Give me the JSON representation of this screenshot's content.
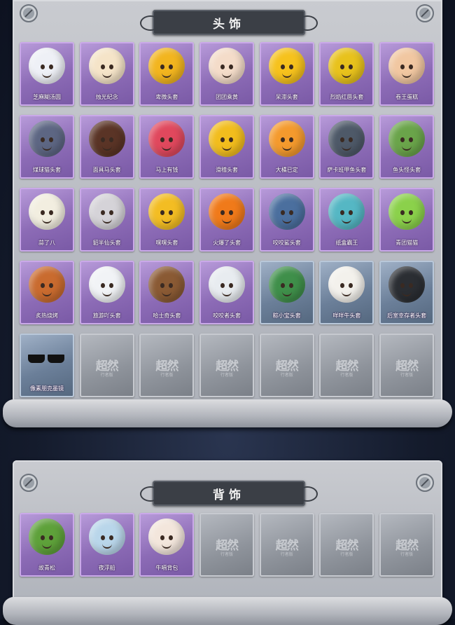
{
  "sections": {
    "head": {
      "title": "头饰",
      "items": [
        {
          "label": "芝麻糊汤圆",
          "rarity": "purple",
          "color": "#eef0f6"
        },
        {
          "label": "烛光纪念",
          "rarity": "purple",
          "color": "#f5e4c8"
        },
        {
          "label": "卑微头套",
          "rarity": "purple",
          "color": "#f2b51f"
        },
        {
          "label": "团团乘黄",
          "rarity": "purple",
          "color": "#f4dcc9"
        },
        {
          "label": "呆滞头套",
          "rarity": "purple",
          "color": "#f6c21d"
        },
        {
          "label": "烈焰红唇头套",
          "rarity": "purple",
          "color": "#e8c21c"
        },
        {
          "label": "卷王蛋糕",
          "rarity": "purple",
          "color": "#f1c7a1"
        },
        {
          "label": "煤球猫头套",
          "rarity": "purple",
          "color": "#5d6683"
        },
        {
          "label": "面具马头套",
          "rarity": "purple",
          "color": "#5a3426"
        },
        {
          "label": "马上有钱",
          "rarity": "purple",
          "color": "#e0485d"
        },
        {
          "label": "滑稽头套",
          "rarity": "purple",
          "color": "#f2bd1d"
        },
        {
          "label": "大橘已定",
          "rarity": "purple",
          "color": "#f49a2d"
        },
        {
          "label": "萨卡班甲鱼头套",
          "rarity": "purple",
          "color": "#4e5968"
        },
        {
          "label": "鱼头怪头套",
          "rarity": "purple",
          "color": "#6aa44a"
        },
        {
          "label": "蒜了八",
          "rarity": "purple",
          "color": "#f2eee0"
        },
        {
          "label": "貂半仙头套",
          "rarity": "purple",
          "color": "#d5d3d8"
        },
        {
          "label": "嘿嘿头套",
          "rarity": "purple",
          "color": "#f3bd23"
        },
        {
          "label": "火爆了头套",
          "rarity": "purple",
          "color": "#f07a1a"
        },
        {
          "label": "咬咬鲨头套",
          "rarity": "purple",
          "color": "#4b6f9e"
        },
        {
          "label": "纸盒霸王",
          "rarity": "purple",
          "color": "#55b7c4"
        },
        {
          "label": "青团猫猫",
          "rarity": "purple",
          "color": "#8bd14b"
        },
        {
          "label": "炙热烧烤",
          "rarity": "purple",
          "color": "#c96b2f"
        },
        {
          "label": "旅游吖头套",
          "rarity": "purple",
          "color": "#f1f3f6"
        },
        {
          "label": "哈士奇头套",
          "rarity": "purple",
          "color": "#8a5a34"
        },
        {
          "label": "咬咬者头套",
          "rarity": "purple",
          "color": "#e8ecf0"
        },
        {
          "label": "粽小宝头套",
          "rarity": "blue",
          "color": "#3f8f4a"
        },
        {
          "label": "咩咩牛头套",
          "rarity": "blue",
          "color": "#f3f1ec"
        },
        {
          "label": "后室幸存者头套",
          "rarity": "blue",
          "color": "#2b2e33"
        },
        {
          "label": "像素朋克墨镜",
          "rarity": "blue",
          "color": "#111111"
        }
      ],
      "locked_count": 6
    },
    "back": {
      "title": "背饰",
      "items": [
        {
          "label": "故青松",
          "rarity": "purple",
          "color": "#5ea13a"
        },
        {
          "label": "夜浮船",
          "rarity": "purple",
          "color": "#b9d6ea"
        },
        {
          "label": "牛嗝背包",
          "rarity": "purple",
          "color": "#f3e6dc"
        }
      ],
      "locked_count": 4
    }
  },
  "locked_watermark": {
    "main": "超然",
    "sub": "行者版"
  }
}
